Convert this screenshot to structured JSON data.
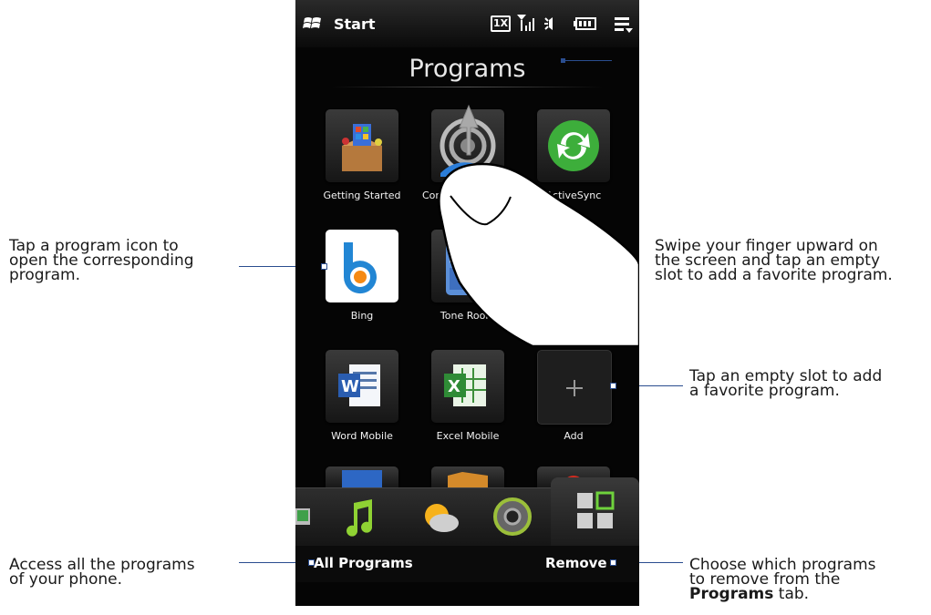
{
  "status": {
    "start_label": "Start",
    "network": "1X"
  },
  "screen": {
    "title": "Programs"
  },
  "programs": [
    {
      "label": "Getting Started"
    },
    {
      "label": "Comm"
    },
    {
      "label": "ActiveSync"
    },
    {
      "label": "Bing"
    },
    {
      "label": "Tone Room"
    },
    {
      "label": ""
    },
    {
      "label": "Word Mobile"
    },
    {
      "label": "Excel Mobile"
    },
    {
      "label": "Add"
    }
  ],
  "softkeys": {
    "left": "All Programs",
    "right": "Remove"
  },
  "tabs": [
    "photos",
    "music",
    "weather",
    "settings",
    "programs"
  ],
  "callouts": {
    "tap_icon_1": "Tap a program icon to",
    "tap_icon_2": "open the corresponding",
    "tap_icon_3": "program.",
    "swipe_1": "Swipe your finger upward on",
    "swipe_2": "the screen and tap an empty",
    "swipe_3": "slot to add a favorite program.",
    "empty_1": "Tap an empty slot to add",
    "empty_2": "a favorite program.",
    "access_1": "Access all the programs",
    "access_2": "of your phone.",
    "choose_1": "Choose which programs",
    "choose_2": "to remove from the",
    "choose_3_bold": "Programs",
    "choose_3_rest": " tab."
  },
  "colors": {
    "leader": "#2a4d8f",
    "phone_bg": "#050505",
    "text": "#1a1a1a"
  }
}
